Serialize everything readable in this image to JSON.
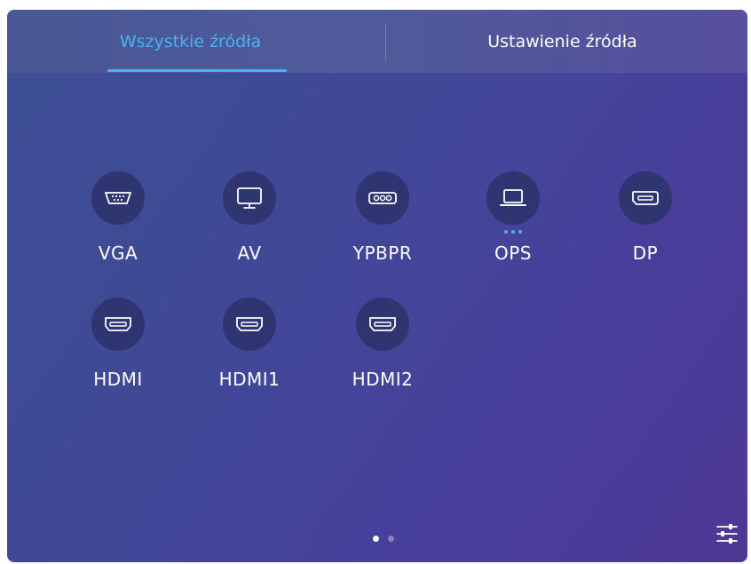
{
  "tabs": {
    "all_sources": "Wszystkie źródła",
    "source_settings": "Ustawienie źródła"
  },
  "sources": [
    {
      "label": "VGA",
      "icon": "vga-port-icon"
    },
    {
      "label": "AV",
      "icon": "monitor-icon"
    },
    {
      "label": "YPBPR",
      "icon": "component-port-icon"
    },
    {
      "label": "OPS",
      "icon": "laptop-icon"
    },
    {
      "label": "DP",
      "icon": "displayport-icon"
    },
    {
      "label": "HDMI",
      "icon": "hdmi-port-icon"
    },
    {
      "label": "HDMI1",
      "icon": "hdmi-port-icon"
    },
    {
      "label": "HDMI2",
      "icon": "hdmi-port-icon"
    }
  ],
  "pagination": {
    "current_page": 1,
    "total_pages": 2
  },
  "colors": {
    "accent": "#4ab2ee",
    "icon_circle": "#2f3570",
    "text": "#ffffff"
  }
}
